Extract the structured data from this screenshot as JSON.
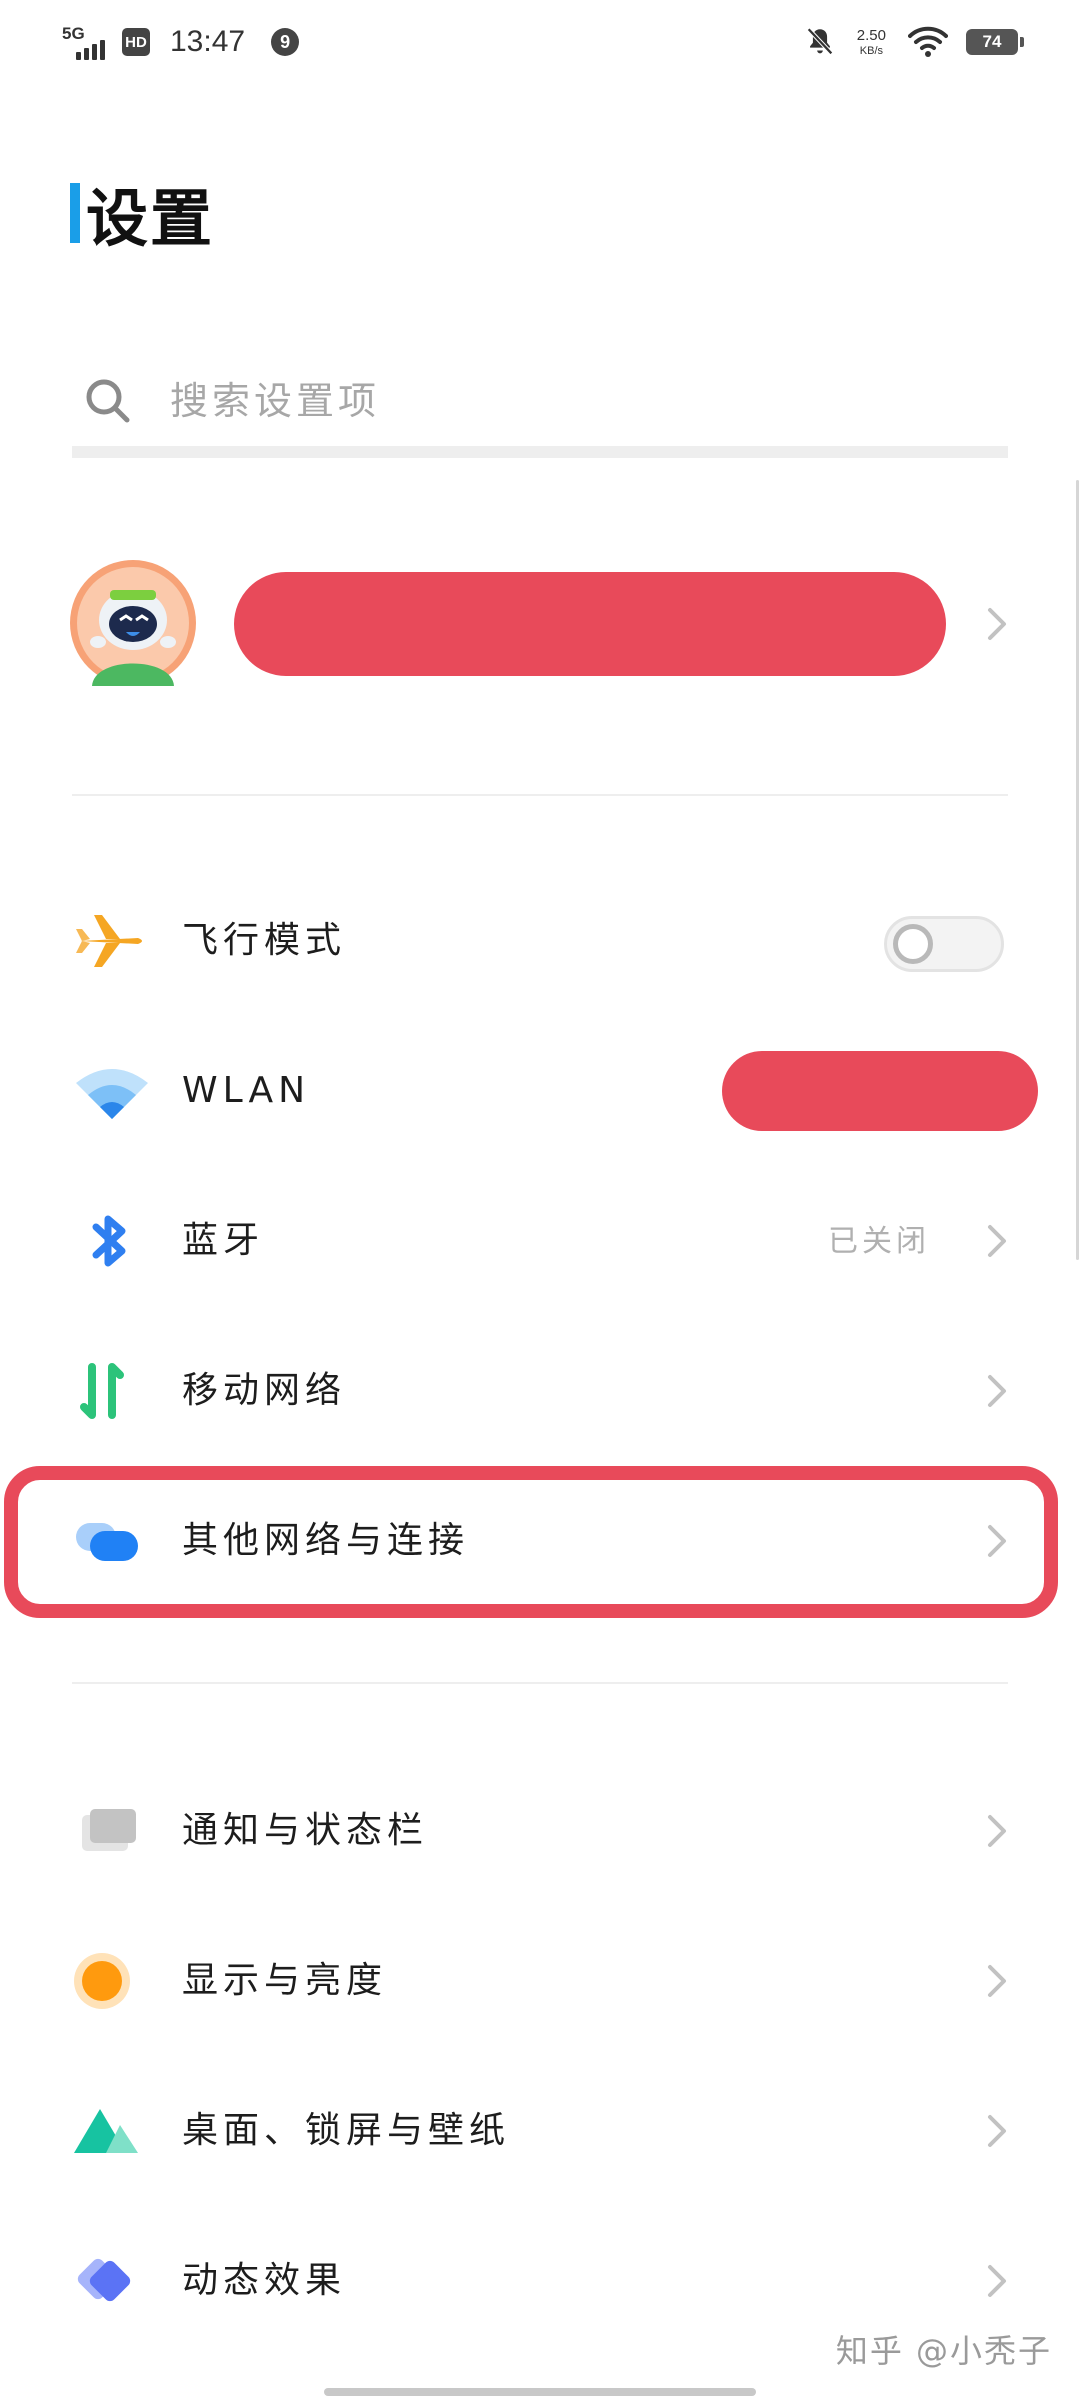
{
  "status_bar": {
    "network": "5G",
    "hd": "HD",
    "time": "13:47",
    "notification_count": "9",
    "speed_value": "2.50",
    "speed_unit": "KB/s",
    "battery": "74"
  },
  "header": {
    "title": "设置"
  },
  "search": {
    "placeholder": "搜索设置项"
  },
  "rows": {
    "airplane": {
      "label": "飞行模式",
      "toggle_on": false
    },
    "wlan": {
      "label": "WLAN"
    },
    "bluetooth": {
      "label": "蓝牙",
      "value": "已关闭"
    },
    "mobile": {
      "label": "移动网络"
    },
    "other_network": {
      "label": "其他网络与连接"
    },
    "notification": {
      "label": "通知与状态栏"
    },
    "display": {
      "label": "显示与亮度"
    },
    "desktop": {
      "label": "桌面、锁屏与壁纸"
    },
    "animation": {
      "label": "动态效果"
    }
  },
  "watermark": "知乎 @小秃子",
  "colors": {
    "accent": "#1a9ee8",
    "redaction": "#e84a5a",
    "airplane": "#f5a623",
    "wifi": "#3d9cf5",
    "bluetooth": "#2f7ff0",
    "mobile": "#2cc37a",
    "display": "#ff9a0e",
    "desktop": "#17c3a1",
    "animation": "#5b73f5"
  }
}
